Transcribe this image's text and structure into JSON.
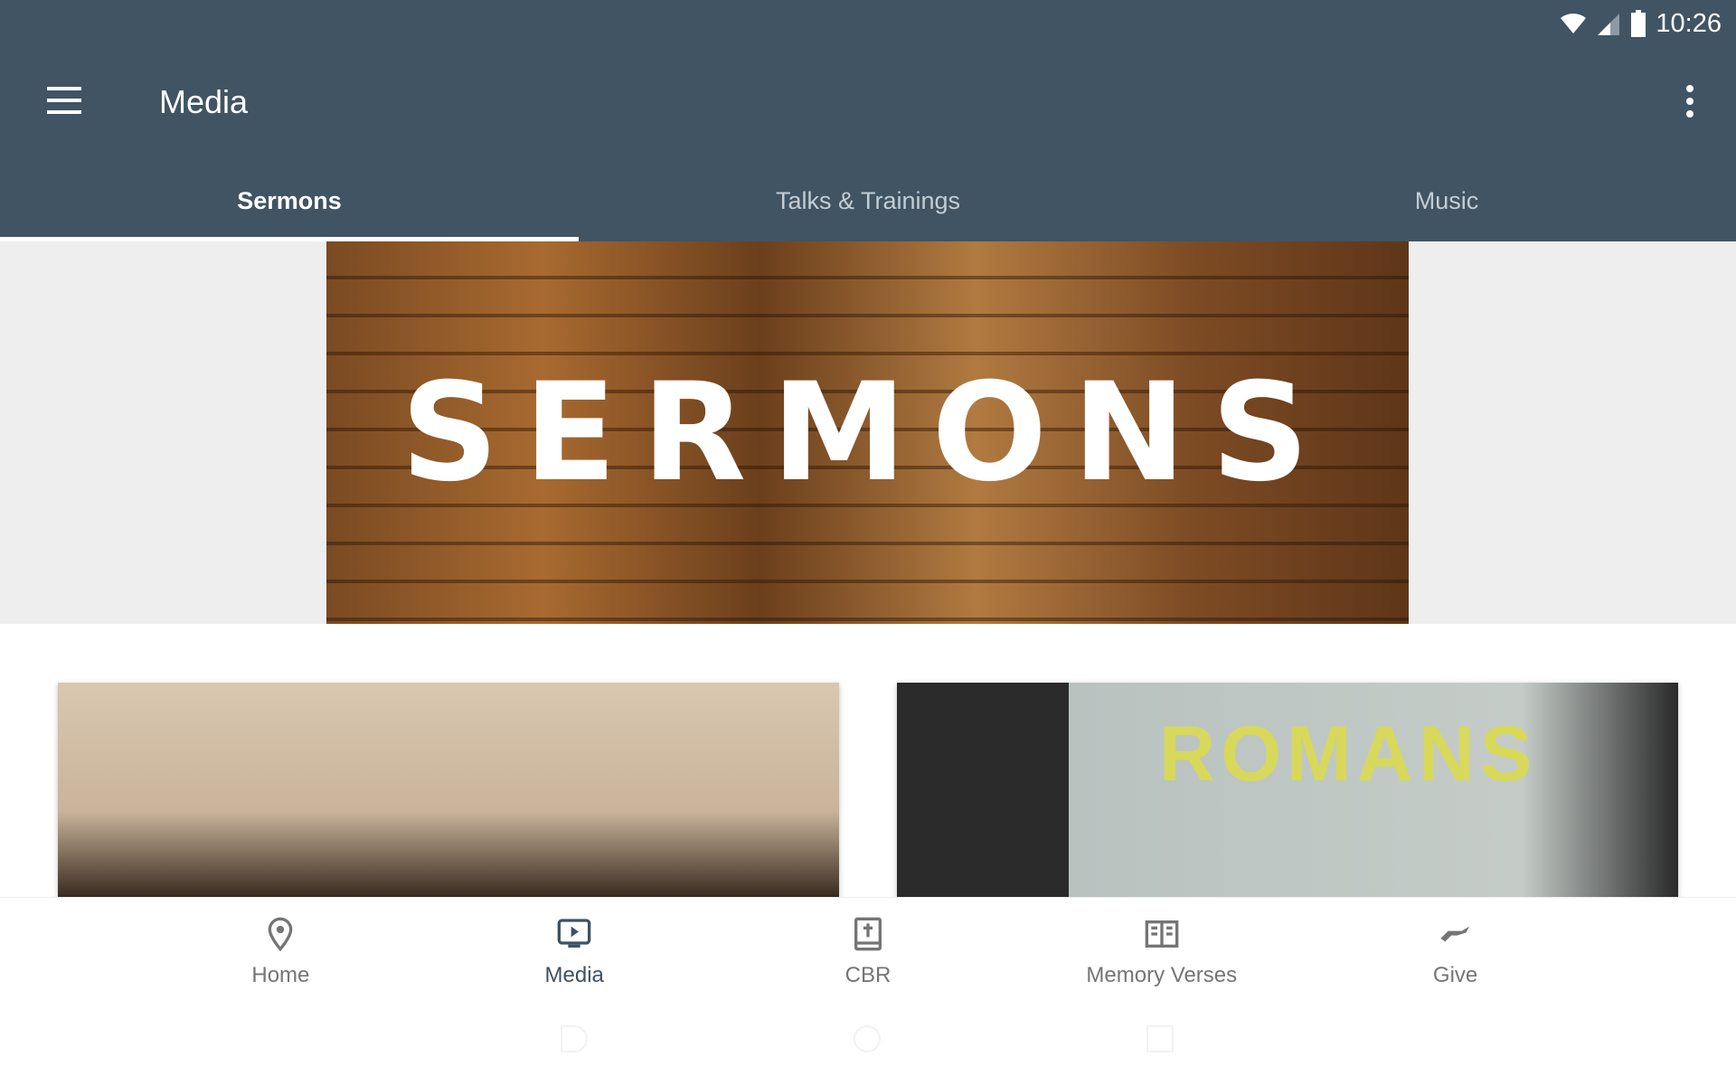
{
  "status_bar": {
    "time": "10:26",
    "icons": [
      "wifi-icon",
      "signal-icon",
      "battery-icon"
    ]
  },
  "app_bar": {
    "title": "Media",
    "menu_icon": "hamburger-menu-icon",
    "overflow_icon": "more-vert-icon"
  },
  "tabs": [
    {
      "label": "Sermons",
      "active": true
    },
    {
      "label": "Talks & Trainings",
      "active": false
    },
    {
      "label": "Music",
      "active": false
    }
  ],
  "banner": {
    "text": "SERMONS"
  },
  "cards": [
    {
      "image": "sermon-speaker-stage"
    },
    {
      "image": "romans-series",
      "overlay_text": "ROMANS"
    }
  ],
  "bottom_nav": [
    {
      "label": "Home",
      "icon": "location-pin-icon",
      "active": false
    },
    {
      "label": "Media",
      "icon": "play-screen-icon",
      "active": true
    },
    {
      "label": "CBR",
      "icon": "bible-icon",
      "active": false
    },
    {
      "label": "Memory Verses",
      "icon": "open-book-icon",
      "active": false
    },
    {
      "label": "Give",
      "icon": "giving-hand-icon",
      "active": false
    }
  ],
  "colors": {
    "primary": "#405463",
    "active_nav": "#3d5263",
    "inactive_nav": "#757575"
  }
}
